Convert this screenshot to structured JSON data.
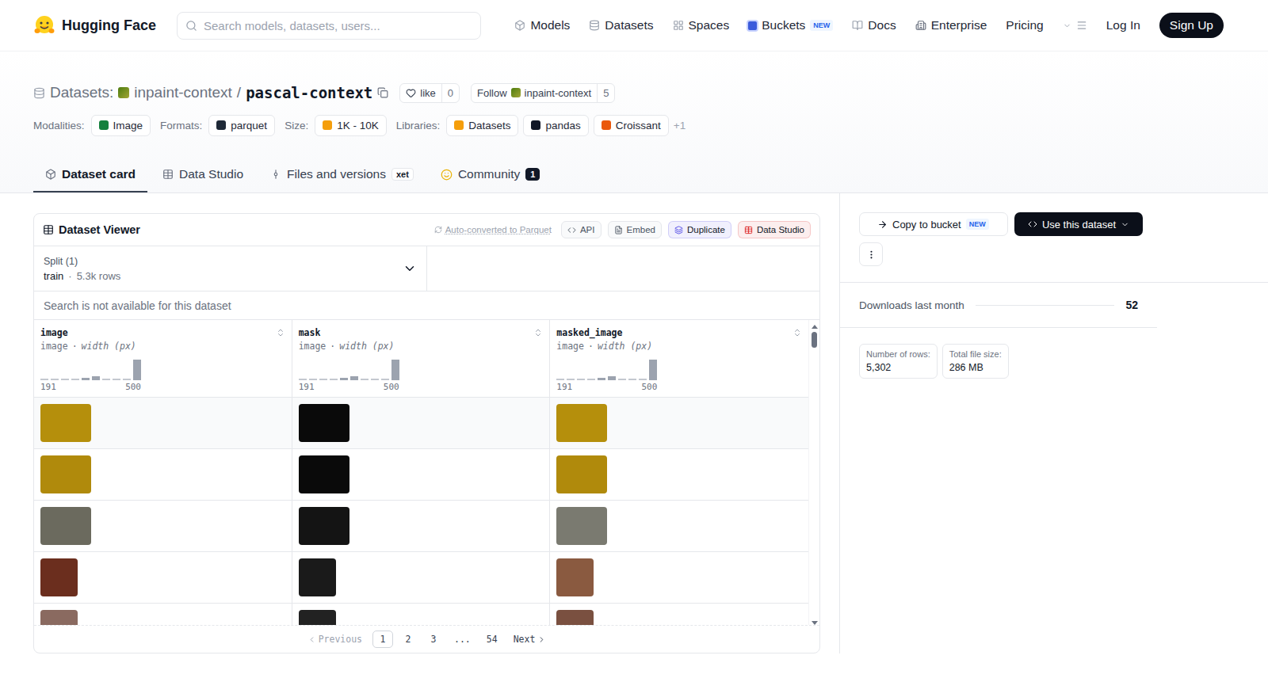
{
  "header": {
    "brand": "Hugging Face",
    "search_placeholder": "Search models, datasets, users...",
    "nav": [
      {
        "label": "Models"
      },
      {
        "label": "Datasets"
      },
      {
        "label": "Spaces"
      },
      {
        "label": "Buckets",
        "badge": "NEW"
      },
      {
        "label": "Docs"
      },
      {
        "label": "Enterprise"
      },
      {
        "label": "Pricing"
      }
    ],
    "login": "Log In",
    "signup": "Sign Up"
  },
  "repo": {
    "type_label": "Datasets:",
    "org": "inpaint-context",
    "separator": "/",
    "name": "pascal-context",
    "like_label": "like",
    "likes": "0",
    "follow_label": "Follow",
    "follow_org": "inpaint-context",
    "followers": "5"
  },
  "tag_groups": [
    {
      "label": "Modalities:",
      "tags": [
        "Image"
      ]
    },
    {
      "label": "Formats:",
      "tags": [
        "parquet"
      ]
    },
    {
      "label": "Size:",
      "tags": [
        "1K - 10K"
      ]
    },
    {
      "label": "Libraries:",
      "tags": [
        "Datasets",
        "pandas",
        "Croissant"
      ],
      "more": "+1"
    }
  ],
  "tabs": [
    {
      "label": "Dataset card",
      "selected": true
    },
    {
      "label": "Data Studio",
      "selected": false
    },
    {
      "label": "Files and versions",
      "badge": "xet",
      "selected": false
    },
    {
      "label": "Community",
      "badge": "1",
      "selected": false
    }
  ],
  "viewer": {
    "title": "Dataset Viewer",
    "converted_note": "Auto-converted to Parquet",
    "actions": [
      {
        "label": "API",
        "color": "#4b5563"
      },
      {
        "label": "Embed",
        "color": "#4b5563"
      },
      {
        "label": "Duplicate",
        "color": "#4f46e5"
      },
      {
        "label": "Data Studio",
        "color": "#dc2626"
      }
    ],
    "split": {
      "label": "Split (1)",
      "name": "train",
      "separator": "·",
      "rows": "5.3k rows"
    },
    "search_note": "Search is not available for this dataset",
    "columns": [
      {
        "name": "image",
        "type": "image",
        "separator": "·",
        "stat": "width (px)",
        "min": "191",
        "max": "500",
        "histogram": [
          0.04,
          0.04,
          0.04,
          0.04,
          0.1,
          0.18,
          0.04,
          0.04,
          0.04,
          1
        ]
      },
      {
        "name": "mask",
        "type": "image",
        "separator": "·",
        "stat": "width (px)",
        "min": "191",
        "max": "500",
        "histogram": [
          0.04,
          0.04,
          0.04,
          0.04,
          0.1,
          0.18,
          0.04,
          0.04,
          0.04,
          1
        ]
      },
      {
        "name": "masked_image",
        "type": "image",
        "separator": "·",
        "stat": "width (px)",
        "min": "191",
        "max": "500",
        "histogram": [
          0.04,
          0.04,
          0.04,
          0.04,
          0.1,
          0.18,
          0.04,
          0.04,
          0.04,
          1
        ]
      }
    ],
    "rows": [
      {
        "kind": "landscape",
        "cells": [
          {
            "color": "#b58f0c"
          },
          {
            "color": "#0a0a0a"
          },
          {
            "color": "#b58f0c"
          }
        ]
      },
      {
        "kind": "landscape",
        "cells": [
          {
            "color": "#b08a0c"
          },
          {
            "color": "#0a0a0a"
          },
          {
            "color": "#b08a0c"
          }
        ]
      },
      {
        "kind": "landscape",
        "cells": [
          {
            "color": "#6b6a5e"
          },
          {
            "color": "#141414"
          },
          {
            "color": "#7a7a70"
          }
        ]
      },
      {
        "kind": "portrait",
        "cells": [
          {
            "color": "#6b2e1e"
          },
          {
            "color": "#1a1a1a"
          },
          {
            "color": "#8a5a40"
          }
        ]
      },
      {
        "kind": "portrait",
        "cells": [
          {
            "color": "#8a6a60"
          },
          {
            "color": "#222222"
          },
          {
            "color": "#7a5040"
          }
        ]
      }
    ],
    "pagination": {
      "previous": "Previous",
      "next": "Next",
      "pages": [
        {
          "label": "1",
          "selected": true
        },
        {
          "label": "2",
          "selected": false
        },
        {
          "label": "3",
          "selected": false
        },
        {
          "label": "...",
          "selected": false
        },
        {
          "label": "54",
          "selected": false
        }
      ]
    }
  },
  "sidebar": {
    "copy": "Copy to bucket",
    "copy_badge": "NEW",
    "use": "Use this dataset",
    "downloads_label": "Downloads last month",
    "downloads": "52",
    "stats": [
      {
        "label": "Number of rows:",
        "value": "5,302"
      },
      {
        "label": "Total file size:",
        "value": "286 MB"
      }
    ]
  }
}
